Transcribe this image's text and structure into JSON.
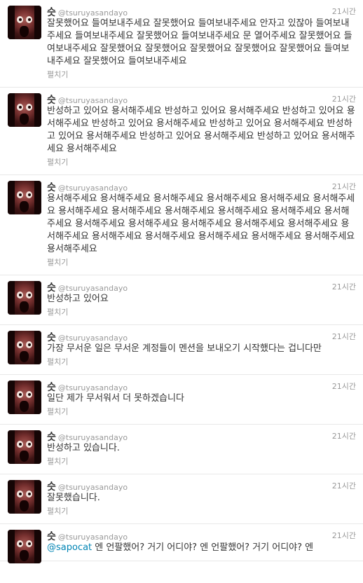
{
  "timeline": {
    "tweets": [
      {
        "fullname": "슷",
        "username": "@tsuruyasandayo",
        "time": "21시간",
        "text": "잘못했어요 들여보내주세요 잘못했어요 들여보내주세요 안자고 있잖아 들여보내주세요 들여보내주세요 잘못했어요 들여보내주세요 문 열어주세요 잘못했어요 들여보내주세요 잘못했어요 잘못했어요 잘못했어요 잘못했어요 잘못했어요 들여보내주세요 잘못했어요 들여보내주세요",
        "expand": "펼치기"
      },
      {
        "fullname": "슷",
        "username": "@tsuruyasandayo",
        "time": "21시간",
        "text": "반성하고 있어요 용서해주세요 반성하고 있어요 용서해주세요 반성하고 있어요 용서해주세요 반성하고 있어요 용서해주세요 반성하고 있어요 용서해주세요 반성하고 있어요 용서해주세요 반성하고 있어요 용서해주세요 반성하고 있어요 용서해주세요 용서해주세요",
        "expand": "펼치기"
      },
      {
        "fullname": "슷",
        "username": "@tsuruyasandayo",
        "time": "21시간",
        "text": "용서해주세요 용서해주세요 용서해주세요 용서해주세요 용서해주세요 용서해주세요 용서해주세요 용서해주세요 용서해주세요 용서해주세요 용서해주세요 용서해주세요 용서해주세요 용서해주세요 용서해주세요 용서해주세요 용서해주세요 용서해주세요 용서해주세요 용서해주세요 용서해주세요 용서해주세요 용서해주세요 용서해주세요",
        "expand": "펼치기"
      },
      {
        "fullname": "슷",
        "username": "@tsuruyasandayo",
        "time": "21시간",
        "text": "반성하고 있어요",
        "expand": "펼치기"
      },
      {
        "fullname": "슷",
        "username": "@tsuruyasandayo",
        "time": "21시간",
        "text": "가장 무서운 일은 무서운 계정들이 멘션을 보내오기 시작했다는 겁니다만",
        "expand": "펼치기"
      },
      {
        "fullname": "슷",
        "username": "@tsuruyasandayo",
        "time": "21시간",
        "text": "일단 제가 무서워서 더 못하겠습니다",
        "expand": "펼치기"
      },
      {
        "fullname": "슷",
        "username": "@tsuruyasandayo",
        "time": "21시간",
        "text": "반성하고 있습니다.",
        "expand": "펼치기"
      },
      {
        "fullname": "슷",
        "username": "@tsuruyasandayo",
        "time": "21시간",
        "text": "잘못했습니다.",
        "expand": "펼치기"
      },
      {
        "fullname": "슷",
        "username": "@tsuruyasandayo",
        "time": "21시간",
        "mention": "@sapocat",
        "text": " 엔 언팔했어? 거기 어디야? 엔 언팔했어? 거기 어디야? 엔",
        "expand": ""
      }
    ]
  },
  "colors": {
    "link": "#0084b4",
    "meta": "#999999",
    "text": "#333333",
    "divider": "#e8e8e8"
  }
}
